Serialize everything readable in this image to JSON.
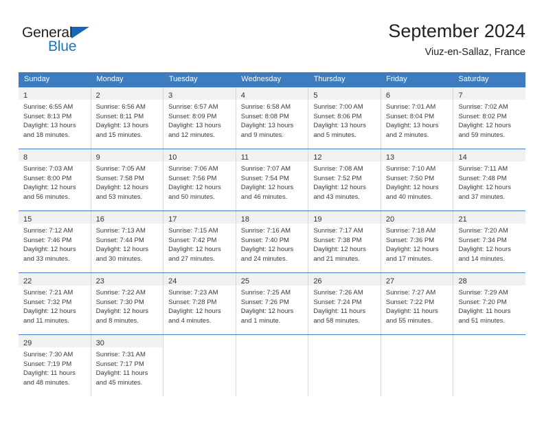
{
  "brand": {
    "name_part1": "General",
    "name_part2": "Blue",
    "triangle_color": "#1567b3",
    "blue_color": "#1b75bb"
  },
  "header": {
    "title": "September 2024",
    "subtitle": "Viuz-en-Sallaz, France"
  },
  "theme": {
    "header_blue": "#3c7cbf",
    "daynum_band": "#f1f1f1",
    "grid_line": "#d8d8d8"
  },
  "weekdays": [
    "Sunday",
    "Monday",
    "Tuesday",
    "Wednesday",
    "Thursday",
    "Friday",
    "Saturday"
  ],
  "weeks": [
    [
      {
        "day": "1",
        "sunrise": "Sunrise: 6:55 AM",
        "sunset": "Sunset: 8:13 PM",
        "daylight_line1": "Daylight: 13 hours",
        "daylight_line2": "and 18 minutes."
      },
      {
        "day": "2",
        "sunrise": "Sunrise: 6:56 AM",
        "sunset": "Sunset: 8:11 PM",
        "daylight_line1": "Daylight: 13 hours",
        "daylight_line2": "and 15 minutes."
      },
      {
        "day": "3",
        "sunrise": "Sunrise: 6:57 AM",
        "sunset": "Sunset: 8:09 PM",
        "daylight_line1": "Daylight: 13 hours",
        "daylight_line2": "and 12 minutes."
      },
      {
        "day": "4",
        "sunrise": "Sunrise: 6:58 AM",
        "sunset": "Sunset: 8:08 PM",
        "daylight_line1": "Daylight: 13 hours",
        "daylight_line2": "and 9 minutes."
      },
      {
        "day": "5",
        "sunrise": "Sunrise: 7:00 AM",
        "sunset": "Sunset: 8:06 PM",
        "daylight_line1": "Daylight: 13 hours",
        "daylight_line2": "and 5 minutes."
      },
      {
        "day": "6",
        "sunrise": "Sunrise: 7:01 AM",
        "sunset": "Sunset: 8:04 PM",
        "daylight_line1": "Daylight: 13 hours",
        "daylight_line2": "and 2 minutes."
      },
      {
        "day": "7",
        "sunrise": "Sunrise: 7:02 AM",
        "sunset": "Sunset: 8:02 PM",
        "daylight_line1": "Daylight: 12 hours",
        "daylight_line2": "and 59 minutes."
      }
    ],
    [
      {
        "day": "8",
        "sunrise": "Sunrise: 7:03 AM",
        "sunset": "Sunset: 8:00 PM",
        "daylight_line1": "Daylight: 12 hours",
        "daylight_line2": "and 56 minutes."
      },
      {
        "day": "9",
        "sunrise": "Sunrise: 7:05 AM",
        "sunset": "Sunset: 7:58 PM",
        "daylight_line1": "Daylight: 12 hours",
        "daylight_line2": "and 53 minutes."
      },
      {
        "day": "10",
        "sunrise": "Sunrise: 7:06 AM",
        "sunset": "Sunset: 7:56 PM",
        "daylight_line1": "Daylight: 12 hours",
        "daylight_line2": "and 50 minutes."
      },
      {
        "day": "11",
        "sunrise": "Sunrise: 7:07 AM",
        "sunset": "Sunset: 7:54 PM",
        "daylight_line1": "Daylight: 12 hours",
        "daylight_line2": "and 46 minutes."
      },
      {
        "day": "12",
        "sunrise": "Sunrise: 7:08 AM",
        "sunset": "Sunset: 7:52 PM",
        "daylight_line1": "Daylight: 12 hours",
        "daylight_line2": "and 43 minutes."
      },
      {
        "day": "13",
        "sunrise": "Sunrise: 7:10 AM",
        "sunset": "Sunset: 7:50 PM",
        "daylight_line1": "Daylight: 12 hours",
        "daylight_line2": "and 40 minutes."
      },
      {
        "day": "14",
        "sunrise": "Sunrise: 7:11 AM",
        "sunset": "Sunset: 7:48 PM",
        "daylight_line1": "Daylight: 12 hours",
        "daylight_line2": "and 37 minutes."
      }
    ],
    [
      {
        "day": "15",
        "sunrise": "Sunrise: 7:12 AM",
        "sunset": "Sunset: 7:46 PM",
        "daylight_line1": "Daylight: 12 hours",
        "daylight_line2": "and 33 minutes."
      },
      {
        "day": "16",
        "sunrise": "Sunrise: 7:13 AM",
        "sunset": "Sunset: 7:44 PM",
        "daylight_line1": "Daylight: 12 hours",
        "daylight_line2": "and 30 minutes."
      },
      {
        "day": "17",
        "sunrise": "Sunrise: 7:15 AM",
        "sunset": "Sunset: 7:42 PM",
        "daylight_line1": "Daylight: 12 hours",
        "daylight_line2": "and 27 minutes."
      },
      {
        "day": "18",
        "sunrise": "Sunrise: 7:16 AM",
        "sunset": "Sunset: 7:40 PM",
        "daylight_line1": "Daylight: 12 hours",
        "daylight_line2": "and 24 minutes."
      },
      {
        "day": "19",
        "sunrise": "Sunrise: 7:17 AM",
        "sunset": "Sunset: 7:38 PM",
        "daylight_line1": "Daylight: 12 hours",
        "daylight_line2": "and 21 minutes."
      },
      {
        "day": "20",
        "sunrise": "Sunrise: 7:18 AM",
        "sunset": "Sunset: 7:36 PM",
        "daylight_line1": "Daylight: 12 hours",
        "daylight_line2": "and 17 minutes."
      },
      {
        "day": "21",
        "sunrise": "Sunrise: 7:20 AM",
        "sunset": "Sunset: 7:34 PM",
        "daylight_line1": "Daylight: 12 hours",
        "daylight_line2": "and 14 minutes."
      }
    ],
    [
      {
        "day": "22",
        "sunrise": "Sunrise: 7:21 AM",
        "sunset": "Sunset: 7:32 PM",
        "daylight_line1": "Daylight: 12 hours",
        "daylight_line2": "and 11 minutes."
      },
      {
        "day": "23",
        "sunrise": "Sunrise: 7:22 AM",
        "sunset": "Sunset: 7:30 PM",
        "daylight_line1": "Daylight: 12 hours",
        "daylight_line2": "and 8 minutes."
      },
      {
        "day": "24",
        "sunrise": "Sunrise: 7:23 AM",
        "sunset": "Sunset: 7:28 PM",
        "daylight_line1": "Daylight: 12 hours",
        "daylight_line2": "and 4 minutes."
      },
      {
        "day": "25",
        "sunrise": "Sunrise: 7:25 AM",
        "sunset": "Sunset: 7:26 PM",
        "daylight_line1": "Daylight: 12 hours",
        "daylight_line2": "and 1 minute."
      },
      {
        "day": "26",
        "sunrise": "Sunrise: 7:26 AM",
        "sunset": "Sunset: 7:24 PM",
        "daylight_line1": "Daylight: 11 hours",
        "daylight_line2": "and 58 minutes."
      },
      {
        "day": "27",
        "sunrise": "Sunrise: 7:27 AM",
        "sunset": "Sunset: 7:22 PM",
        "daylight_line1": "Daylight: 11 hours",
        "daylight_line2": "and 55 minutes."
      },
      {
        "day": "28",
        "sunrise": "Sunrise: 7:29 AM",
        "sunset": "Sunset: 7:20 PM",
        "daylight_line1": "Daylight: 11 hours",
        "daylight_line2": "and 51 minutes."
      }
    ],
    [
      {
        "day": "29",
        "sunrise": "Sunrise: 7:30 AM",
        "sunset": "Sunset: 7:19 PM",
        "daylight_line1": "Daylight: 11 hours",
        "daylight_line2": "and 48 minutes."
      },
      {
        "day": "30",
        "sunrise": "Sunrise: 7:31 AM",
        "sunset": "Sunset: 7:17 PM",
        "daylight_line1": "Daylight: 11 hours",
        "daylight_line2": "and 45 minutes."
      },
      {
        "day": "",
        "sunrise": "",
        "sunset": "",
        "daylight_line1": "",
        "daylight_line2": ""
      },
      {
        "day": "",
        "sunrise": "",
        "sunset": "",
        "daylight_line1": "",
        "daylight_line2": ""
      },
      {
        "day": "",
        "sunrise": "",
        "sunset": "",
        "daylight_line1": "",
        "daylight_line2": ""
      },
      {
        "day": "",
        "sunrise": "",
        "sunset": "",
        "daylight_line1": "",
        "daylight_line2": ""
      },
      {
        "day": "",
        "sunrise": "",
        "sunset": "",
        "daylight_line1": "",
        "daylight_line2": ""
      }
    ]
  ]
}
